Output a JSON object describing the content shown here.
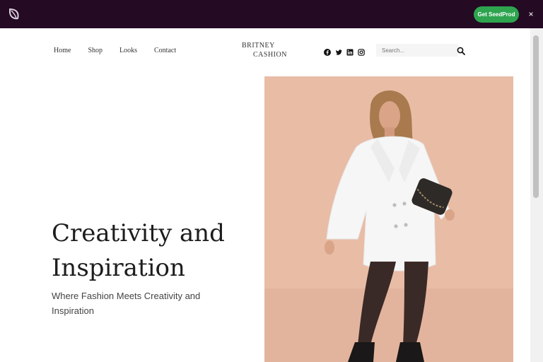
{
  "topbar": {
    "cta_label": "Get SeedProd",
    "close_glyph": "×",
    "logo_icon": "seedprod-leaf-icon",
    "background": "#250a24",
    "cta_color": "#2ea44f"
  },
  "site": {
    "brand_line1": "BRITNEY",
    "brand_line2": "CASHION",
    "nav": [
      "Home",
      "Shop",
      "Looks",
      "Contact"
    ],
    "social_icons": [
      "facebook-icon",
      "twitter-icon",
      "linkedin-icon",
      "instagram-icon"
    ],
    "search_placeholder": "Search..."
  },
  "hero": {
    "title": "Creativity and Inspiration",
    "subtitle": "Where Fashion Meets Creativity and Inspiration",
    "image_background": "#e6b7a0"
  }
}
